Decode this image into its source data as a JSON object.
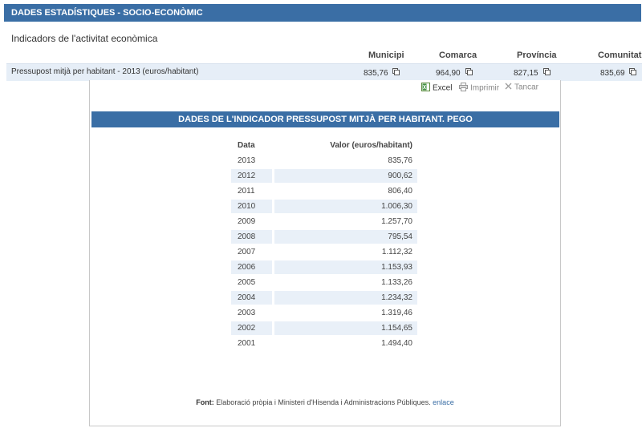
{
  "header": {
    "title": "DADES ESTADÍSTIQUES - SOCIO-ECONÒMIC"
  },
  "section": {
    "title": "Indicadors de l'activitat econòmica"
  },
  "columns": [
    "Municipi",
    "Comarca",
    "Província",
    "Comunitat"
  ],
  "indicator": {
    "label": "Pressupost mitjà per habitant - 2013 (euros/habitant)",
    "values": [
      "835,76",
      "964,90",
      "827,15",
      "835,69"
    ]
  },
  "toolbar": {
    "excel": "Excel",
    "print": "Imprimir",
    "cancel": "Tancar"
  },
  "popup": {
    "title": "DADES DE L'INDICADOR PRESSUPOST MITJÀ PER HABITANT. PEGO",
    "col_date": "Data",
    "col_value": "Valor  (euros/habitant)",
    "rows": [
      {
        "date": "2013",
        "value": "835,76"
      },
      {
        "date": "2012",
        "value": "900,62"
      },
      {
        "date": "2011",
        "value": "806,40"
      },
      {
        "date": "2010",
        "value": "1.006,30"
      },
      {
        "date": "2009",
        "value": "1.257,70"
      },
      {
        "date": "2008",
        "value": "795,54"
      },
      {
        "date": "2007",
        "value": "1.112,32"
      },
      {
        "date": "2006",
        "value": "1.153,93"
      },
      {
        "date": "2005",
        "value": "1.133,26"
      },
      {
        "date": "2004",
        "value": "1.234,32"
      },
      {
        "date": "2003",
        "value": "1.319,46"
      },
      {
        "date": "2002",
        "value": "1.154,65"
      },
      {
        "date": "2001",
        "value": "1.494,40"
      }
    ],
    "footer_label": "Font:",
    "footer_text": "Elaboració pròpia i Ministeri d'Hisenda i Administracions Públiques.",
    "footer_link": "enlace"
  },
  "colors": {
    "accent": "#3a6ea5",
    "row_alt": "#e9f0f8",
    "indicator_row": "#e6eef7"
  },
  "icons": {
    "copy": "copy-icon",
    "excel": "excel-icon",
    "print": "printer-icon",
    "close": "close-icon"
  }
}
